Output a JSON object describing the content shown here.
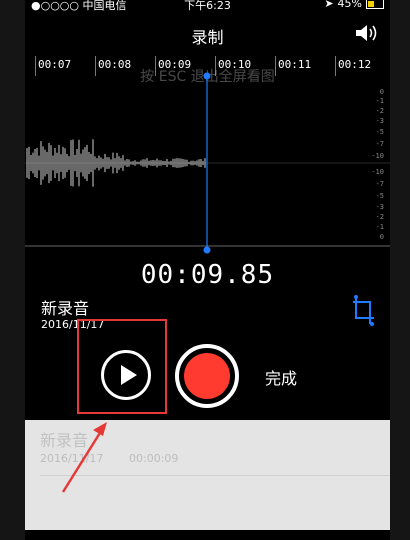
{
  "status_bar": {
    "carrier": "●○○○○ 中国电信",
    "wifi_icon": "wifi-icon",
    "time": "下午6:23",
    "battery": "45%",
    "battery_level": 0.45,
    "battery_color": "#f5d000"
  },
  "nav": {
    "title": "录制",
    "speaker_icon": "speaker-icon"
  },
  "timeline": {
    "ticks": [
      "00:07",
      "00:08",
      "00:09",
      "00:10",
      "00:11",
      "00:12"
    ]
  },
  "overlay_hint": "按 ESC 退出全屏看图",
  "db_scale_top": [
    "0",
    "-1",
    "-2",
    "-3",
    "-5",
    "-7",
    "-10"
  ],
  "db_scale_bottom": [
    "-10",
    "-7",
    "-5",
    "-3",
    "-2",
    "-1",
    "0"
  ],
  "timer": "00:09.85",
  "recording": {
    "name": "新录音",
    "date": "2016/11/17"
  },
  "controls": {
    "done_label": "完成",
    "record_color": "#ff3b30"
  },
  "list": {
    "items": [
      {
        "name": "新录音",
        "date": "2016/11/17",
        "duration": "00:00:09"
      }
    ]
  },
  "annotation": {
    "highlight_color": "#e53935"
  }
}
